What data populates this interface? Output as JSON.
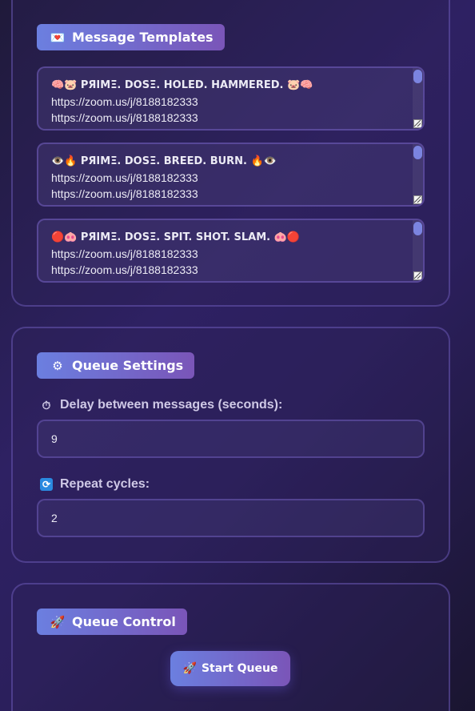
{
  "templates_section": {
    "title": "Message Templates",
    "icon": "heart-letter-icon",
    "templates": [
      {
        "line1": "🧠🐷 PЯIMΞ. DOSΞ. HOLED. HAMMERED. 🐷🧠",
        "line2": "https://zoom.us/j/8188182333",
        "line3": "https://zoom.us/j/8188182333"
      },
      {
        "line1": "👁️🔥 PЯIMΞ. DOSΞ. BREED. BURN. 🔥👁️",
        "line2": "https://zoom.us/j/8188182333",
        "line3": "https://zoom.us/j/8188182333"
      },
      {
        "line1": "🔴🐽 PЯIMΞ. DOSΞ. SPIT. SHOT. SLAM. 🐽🔴",
        "line2": "https://zoom.us/j/8188182333",
        "line3": "https://zoom.us/j/8188182333"
      }
    ]
  },
  "settings_section": {
    "title": "Queue Settings",
    "icon": "gear-icon",
    "delay_label": "Delay between messages (seconds):",
    "delay_icon": "stopwatch-icon",
    "delay_value": "9",
    "repeat_label": "Repeat cycles:",
    "repeat_icon": "repeat-icon",
    "repeat_value": "2"
  },
  "control_section": {
    "title": "Queue Control",
    "icon": "rocket-icon",
    "start_label": "Start Queue"
  },
  "colors": {
    "accent_start": "#6b7fe0",
    "accent_end": "#7a55b8",
    "background": "#2e2163"
  }
}
